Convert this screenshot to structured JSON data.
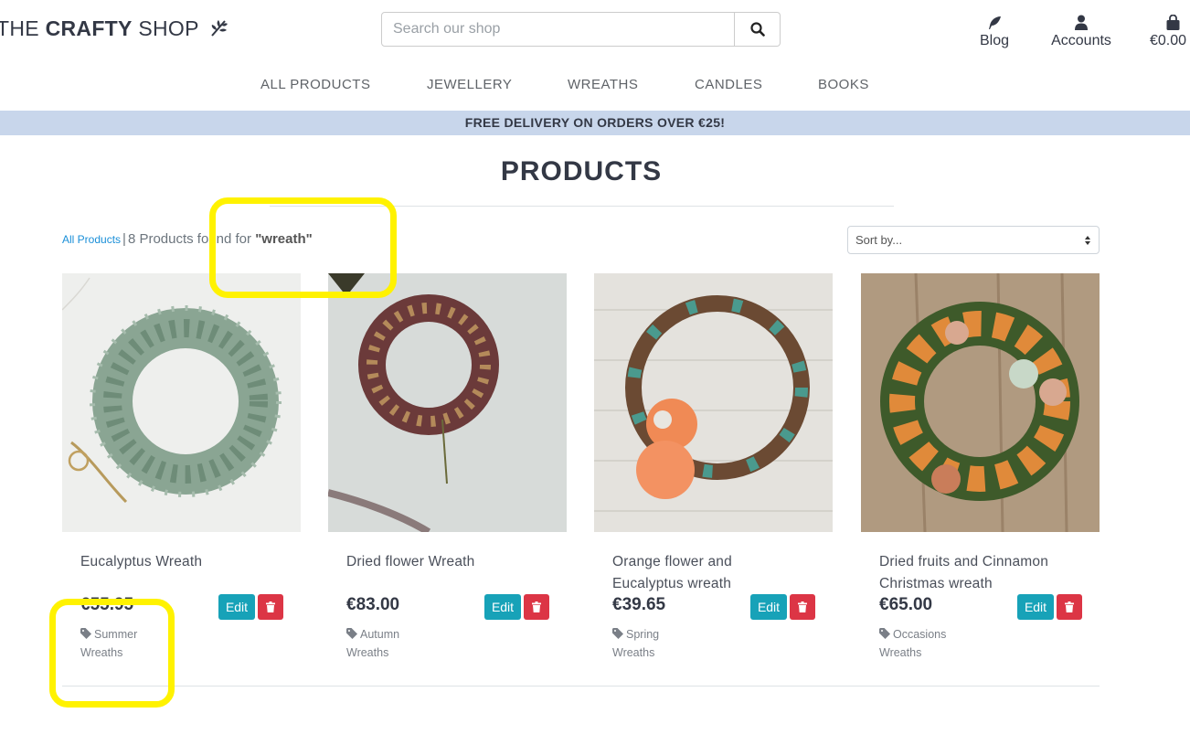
{
  "header": {
    "logo_prefix": "THE ",
    "logo_bold": "CRAFTY",
    "logo_suffix": " SHOP",
    "search": {
      "placeholder": "Search our shop",
      "value": ""
    },
    "nav": [
      {
        "label": "Blog",
        "icon": "feather-icon"
      },
      {
        "label": "Accounts",
        "icon": "user-icon"
      },
      {
        "label": "€0.00",
        "icon": "shopping-bag-icon"
      }
    ]
  },
  "main_nav": [
    "ALL PRODUCTS",
    "JEWELLERY",
    "WREATHS",
    "CANDLES",
    "BOOKS"
  ],
  "banner": "FREE DELIVERY ON ORDERS OVER €25!",
  "page_title": "PRODUCTS",
  "results": {
    "all_link": "All Products",
    "separator": "|",
    "count_text": "8 Products found for ",
    "term": "\"wreath\""
  },
  "sort": {
    "selected": "Sort by..."
  },
  "products": [
    {
      "name": "Eucalyptus Wreath",
      "price": "€55.95",
      "category": "Summer Wreaths",
      "edit": "Edit"
    },
    {
      "name": "Dried flower Wreath",
      "price": "€83.00",
      "category": "Autumn Wreaths",
      "edit": "Edit"
    },
    {
      "name": "Orange flower and Eucalyptus wreath",
      "price": "€39.65",
      "category": "Spring Wreaths",
      "edit": "Edit"
    },
    {
      "name": "Dried fruits and Cinnamon Christmas wreath",
      "price": "€65.00",
      "category": "Occasions Wreaths",
      "edit": "Edit"
    }
  ],
  "colors": {
    "banner_bg": "#c8d6eb",
    "edit_button": "#17a2b8",
    "delete_button": "#dc3545",
    "link": "#1a8fd8",
    "highlight": "#fff200"
  }
}
